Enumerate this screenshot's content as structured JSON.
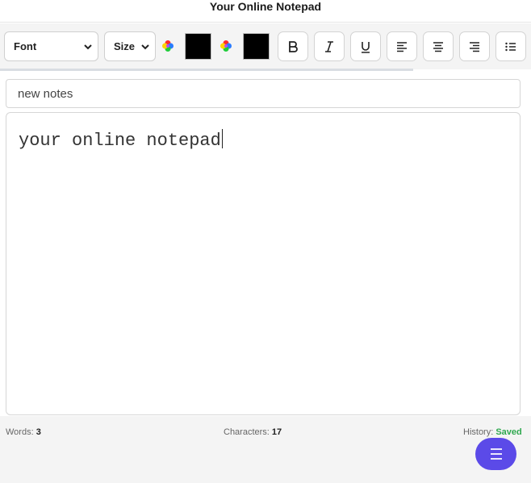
{
  "header": {
    "title": "Your Online Notepad"
  },
  "toolbar": {
    "font_select": "Font",
    "size_select": "Size",
    "text_color": "#000000",
    "highlight_color": "#000000",
    "buttons": {
      "bold": "bold-icon",
      "italic": "italic-icon",
      "underline": "underline-icon",
      "align_left": "align-left-icon",
      "align_center": "align-center-icon",
      "align_right": "align-right-icon",
      "list": "list-icon"
    }
  },
  "note": {
    "title_value": "new notes",
    "body": "your online notepad"
  },
  "status": {
    "words_label": "Words:",
    "words_value": "3",
    "chars_label": "Characters:",
    "chars_value": "17",
    "history_label": "History:",
    "history_value": "Saved"
  },
  "fab": {
    "icon": "menu-icon",
    "color": "#5b4ae8"
  }
}
